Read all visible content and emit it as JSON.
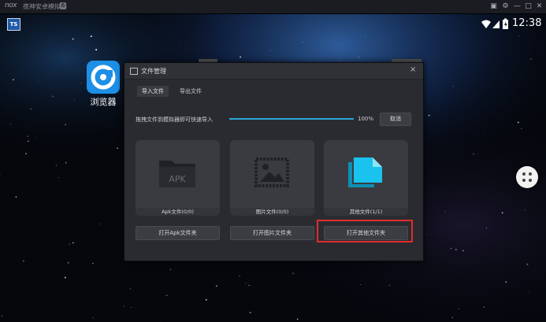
{
  "emulator": {
    "logo": "nox",
    "title": "夜神安卓模拟器",
    "badge": "6",
    "controls": [
      "▣",
      "⚙",
      "—",
      "□",
      "✕"
    ]
  },
  "status_bar": {
    "clock": "12:38",
    "app_badge": "TS"
  },
  "desktop": {
    "browser_label": "浏览器"
  },
  "dialog": {
    "title": "文件管理",
    "close": "×",
    "tabs": [
      {
        "label": "导入文件",
        "active": true
      },
      {
        "label": "导出文件",
        "active": false
      }
    ],
    "drop_hint": "拖拽文件到模拟器即可快速导入",
    "progress": {
      "percent": 100,
      "label": "100%"
    },
    "cancel_label": "取消",
    "cards": [
      {
        "art": "apk-folder-icon",
        "art_text": "APK",
        "label": "Apk文件(0/0)"
      },
      {
        "art": "image-icon",
        "label": "图片文件(0/0)"
      },
      {
        "art": "document-icon",
        "label": "其他文件(1/1)"
      }
    ],
    "buttons": [
      {
        "label": "打开Apk文件夹"
      },
      {
        "label": "打开图片文件夹"
      },
      {
        "label": "打开其他文件夹"
      }
    ]
  },
  "colors": {
    "accent": "#2aa6d8",
    "document": "#19c3ee",
    "highlight": "#e02d2d",
    "dialog_bg": "#2a2b30"
  }
}
